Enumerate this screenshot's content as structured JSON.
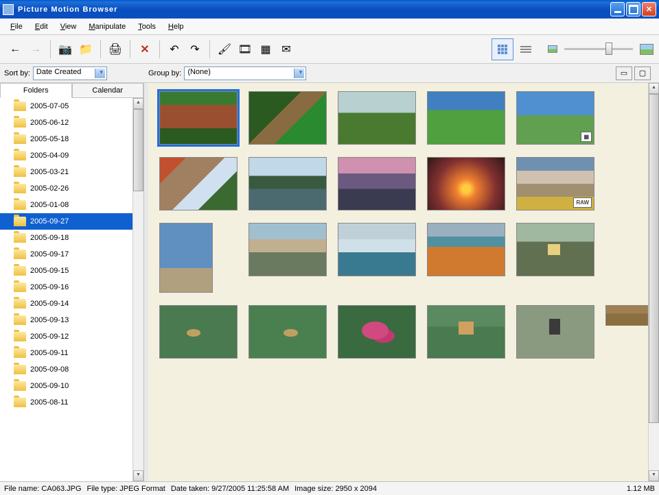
{
  "window": {
    "title": "Picture Motion Browser"
  },
  "menus": {
    "file": "File",
    "edit": "Edit",
    "view": "View",
    "manipulate": "Manipulate",
    "tools": "Tools",
    "help": "Help"
  },
  "filter": {
    "sortby_label": "Sort by:",
    "sortby_value": "Date Created",
    "groupby_label": "Group by:",
    "groupby_value": "(None)"
  },
  "tabs": {
    "folders": "Folders",
    "calendar": "Calendar"
  },
  "folders": [
    "2005-07-05",
    "2005-06-12",
    "2005-05-18",
    "2005-04-09",
    "2005-03-21",
    "2005-02-26",
    "2005-01-08",
    "2005-09-27",
    "2005-09-18",
    "2005-09-17",
    "2005-09-15",
    "2005-09-16",
    "2005-09-14",
    "2005-09-13",
    "2005-09-12",
    "2005-09-11",
    "2005-09-08",
    "2005-09-10",
    "2005-08-11"
  ],
  "selected_folder_index": 7,
  "thumbnails": [
    {
      "class": "img-dog",
      "selected": true
    },
    {
      "class": "img-cat"
    },
    {
      "class": "img-field1"
    },
    {
      "class": "img-field2"
    },
    {
      "class": "img-tree",
      "badge": "film-icon"
    },
    {
      "class": "img-stream"
    },
    {
      "class": "img-lake"
    },
    {
      "class": "img-sunset1"
    },
    {
      "class": "img-sunset2"
    },
    {
      "class": "img-mountain",
      "badge": "RAW"
    },
    {
      "class": "img-deadtree",
      "portrait": true
    },
    {
      "class": "img-tetons"
    },
    {
      "class": "img-geyser"
    },
    {
      "class": "img-prismatic"
    },
    {
      "class": "img-birdflower"
    },
    {
      "class": "img-bird1"
    },
    {
      "class": "img-bird2"
    },
    {
      "class": "img-flowers"
    },
    {
      "class": "img-bird3"
    },
    {
      "class": "img-bird4"
    },
    {
      "class": "img-partial",
      "partial": true
    }
  ],
  "status": {
    "filename_label": "File name:",
    "filename": "CA063.JPG",
    "filetype_label": "File type:",
    "filetype": "JPEG Format",
    "datetaken_label": "Date taken:",
    "datetaken": "9/27/2005 11:25:58 AM",
    "imagesize_label": "Image size:",
    "imagesize": "2950 x 2094",
    "filesize": "1.12 MB"
  }
}
